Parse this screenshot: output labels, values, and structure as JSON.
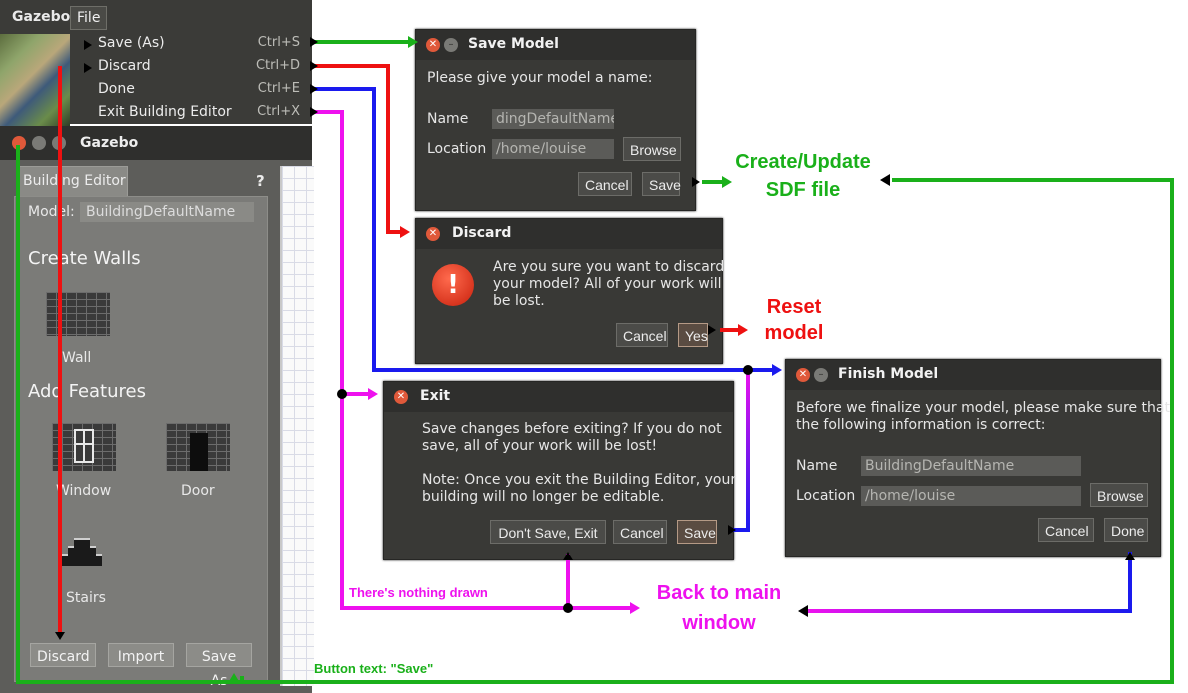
{
  "gazebo_menu": {
    "app_name": "Gazebo",
    "file_menu": "File",
    "items": [
      {
        "label": "Save (As)",
        "shortcut": "Ctrl+S"
      },
      {
        "label": "Discard",
        "shortcut": "Ctrl+D"
      },
      {
        "label": "Done",
        "shortcut": "Ctrl+E"
      },
      {
        "label": "Exit Building Editor",
        "shortcut": "Ctrl+X"
      }
    ]
  },
  "editor": {
    "window_title": "Gazebo",
    "tab_label": "Building Editor",
    "help": "?",
    "model_label": "Model:",
    "model_name": "BuildingDefaultName",
    "create_walls_heading": "Create Walls",
    "wall_label": "Wall",
    "add_features_heading": "Add Features",
    "window_label": "Window",
    "door_label": "Door",
    "stairs_label": "Stairs",
    "discard_button": "Discard",
    "import_button": "Import",
    "save_as_button": "Save As"
  },
  "save_dialog": {
    "title": "Save Model",
    "prompt": "Please give your model a name:",
    "name_label": "Name",
    "name_value": "dingDefaultName",
    "location_label": "Location",
    "location_value": "/home/louise",
    "browse_button": "Browse",
    "cancel_button": "Cancel",
    "save_button": "Save"
  },
  "discard_dialog": {
    "title": "Discard",
    "message_lines": [
      "Are you sure you want to discard",
      "your model? All of your work will",
      "be lost."
    ],
    "cancel_button": "Cancel",
    "yes_button": "Yes"
  },
  "exit_dialog": {
    "title": "Exit",
    "message_lines": [
      "Save changes before exiting? If you do not",
      "save, all of your work will be lost!"
    ],
    "note_lines": [
      "Note: Once you exit the Building Editor, your",
      "building will no longer be editable."
    ],
    "dont_save_button": "Don't Save, Exit",
    "cancel_button": "Cancel",
    "save_button": "Save"
  },
  "finish_dialog": {
    "title": "Finish Model",
    "message_lines": [
      "Before we finalize your model, please make sure that",
      "the following information is correct:"
    ],
    "name_label": "Name",
    "name_value": "BuildingDefaultName",
    "location_label": "Location",
    "location_value": "/home/louise",
    "browse_button": "Browse",
    "cancel_button": "Cancel",
    "done_button": "Done"
  },
  "annotations": {
    "create_update": [
      "Create/Update",
      "SDF file"
    ],
    "reset_model": [
      "Reset",
      "model"
    ],
    "back_to_main": [
      "Back to main",
      "window"
    ],
    "nothing_drawn": "There's nothing drawn",
    "button_text_note": "Button text: \"Save\""
  },
  "colors": {
    "green": "#1ab01a",
    "red": "#ee1111",
    "blue": "#1a1aee",
    "magenta": "#ee11ee"
  }
}
